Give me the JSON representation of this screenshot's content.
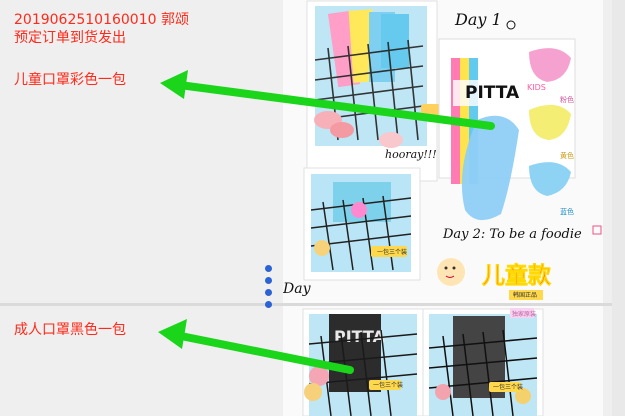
{
  "note": {
    "order_line": "2019062510160010 郭颂",
    "shipping_line": "预定订单到货发出",
    "kids_label": "儿童口罩彩色一包",
    "adult_label": "成人口罩黑色一包"
  },
  "photos": {
    "day1": "Day 1",
    "hooray": "hooray!!!",
    "day2": "Day 2: To be a foodie",
    "day_partial": "Day",
    "brand": "PITTA",
    "brand_kids": "KIDS",
    "color_pink": "粉色",
    "color_yellow": "黄色",
    "color_blue": "蓝色",
    "kids_title": "儿童款",
    "pack_label": "一包三个装",
    "sticker_text": "独家原装",
    "tag_text": "韩国正品"
  },
  "colors": {
    "annotation_red": "#ff2a1a",
    "arrow_green": "#22dd22",
    "selection_blue": "#2b62d4"
  }
}
